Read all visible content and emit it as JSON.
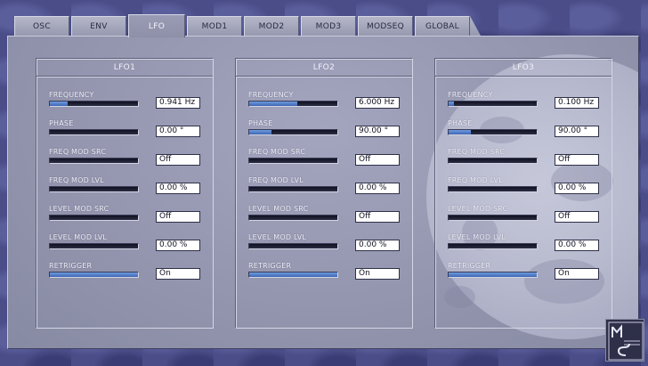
{
  "tabs": [
    {
      "label": "OSC"
    },
    {
      "label": "ENV"
    },
    {
      "label": "LFO"
    },
    {
      "label": "MOD1"
    },
    {
      "label": "MOD2"
    },
    {
      "label": "MOD3"
    },
    {
      "label": "MODSEQ"
    },
    {
      "label": "GLOBAL"
    }
  ],
  "active_tab": "LFO",
  "colors": {
    "accent": "#4a74c4",
    "background": "#4a4d88",
    "panel": "#9799b2"
  },
  "logo": {
    "text": "MUSIC SOCIETY"
  },
  "lfos": [
    {
      "title": "LFO1",
      "params": [
        {
          "label": "FREQUENCY",
          "value": "0.941 Hz",
          "level": 0.2
        },
        {
          "label": "PHASE",
          "value": "0.00 °",
          "level": 0.0
        },
        {
          "label": "FREQ MOD SRC",
          "value": "Off",
          "level": 0.0
        },
        {
          "label": "FREQ MOD LVL",
          "value": "0.00 %",
          "level": 0.0
        },
        {
          "label": "LEVEL MOD SRC",
          "value": "Off",
          "level": 0.0
        },
        {
          "label": "LEVEL MOD LVL",
          "value": "0.00 %",
          "level": 0.0
        },
        {
          "label": "RETRIGGER",
          "value": "On",
          "level": 1.0
        }
      ]
    },
    {
      "title": "LFO2",
      "params": [
        {
          "label": "FREQUENCY",
          "value": "6.000 Hz",
          "level": 0.55
        },
        {
          "label": "PHASE",
          "value": "90.00 °",
          "level": 0.25
        },
        {
          "label": "FREQ MOD SRC",
          "value": "Off",
          "level": 0.0
        },
        {
          "label": "FREQ MOD LVL",
          "value": "0.00 %",
          "level": 0.0
        },
        {
          "label": "LEVEL MOD SRC",
          "value": "Off",
          "level": 0.0
        },
        {
          "label": "LEVEL MOD LVL",
          "value": "0.00 %",
          "level": 0.0
        },
        {
          "label": "RETRIGGER",
          "value": "On",
          "level": 1.0
        }
      ]
    },
    {
      "title": "LFO3",
      "params": [
        {
          "label": "FREQUENCY",
          "value": "0.100 Hz",
          "level": 0.06
        },
        {
          "label": "PHASE",
          "value": "90.00 °",
          "level": 0.25
        },
        {
          "label": "FREQ MOD SRC",
          "value": "Off",
          "level": 0.0
        },
        {
          "label": "FREQ MOD LVL",
          "value": "0.00 %",
          "level": 0.0
        },
        {
          "label": "LEVEL MOD SRC",
          "value": "Off",
          "level": 0.0
        },
        {
          "label": "LEVEL MOD LVL",
          "value": "0.00 %",
          "level": 0.0
        },
        {
          "label": "RETRIGGER",
          "value": "On",
          "level": 1.0
        }
      ]
    }
  ]
}
